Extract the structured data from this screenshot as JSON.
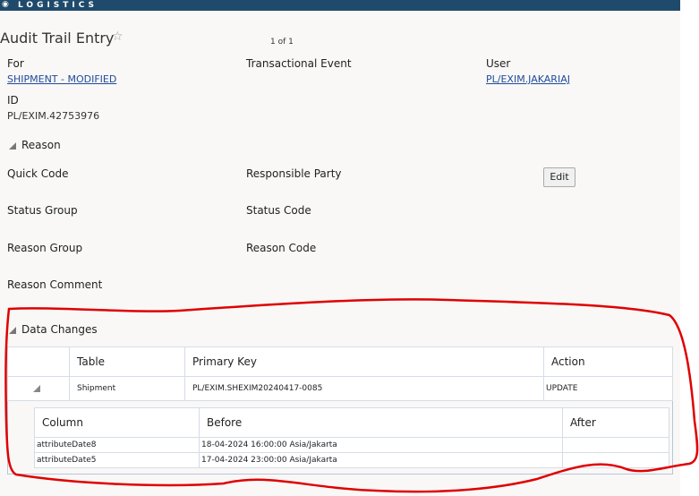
{
  "header": {
    "logo_icon": "o-logo",
    "brand": "LOGISTICS"
  },
  "page": {
    "title": "Audit Trail Entry",
    "favorite_icon": "star-icon",
    "pager": "1 of 1"
  },
  "fields": {
    "for_label": "For",
    "for_value": "SHIPMENT - MODIFIED",
    "event_label": "Transactional Event",
    "user_label": "User",
    "user_value": "PL/EXIM.JAKARIAJ",
    "id_label": "ID",
    "id_value": "PL/EXIM.42753976"
  },
  "reason": {
    "title": "Reason",
    "quick_code": "Quick Code",
    "responsible_party": "Responsible Party",
    "edit": "Edit",
    "status_group": "Status Group",
    "status_code": "Status Code",
    "reason_group": "Reason Group",
    "reason_code": "Reason Code",
    "reason_comment": "Reason Comment"
  },
  "data_changes": {
    "title": "Data Changes",
    "headers": [
      "Table",
      "Primary Key",
      "Action"
    ],
    "rows": [
      {
        "table": "Shipment",
        "primary_key": "PL/EXIM.SHEXIM20240417-0085",
        "action": "UPDATE"
      }
    ],
    "detail_headers": [
      "Column",
      "Before",
      "After"
    ],
    "detail_rows": [
      {
        "column": "attributeDate8",
        "before": "18-04-2024 16:00:00 Asia/Jakarta",
        "after": ""
      },
      {
        "column": "attributeDate5",
        "before": "17-04-2024 23:00:00 Asia/Jakarta",
        "after": ""
      }
    ]
  },
  "annotation_color": "#e00000"
}
